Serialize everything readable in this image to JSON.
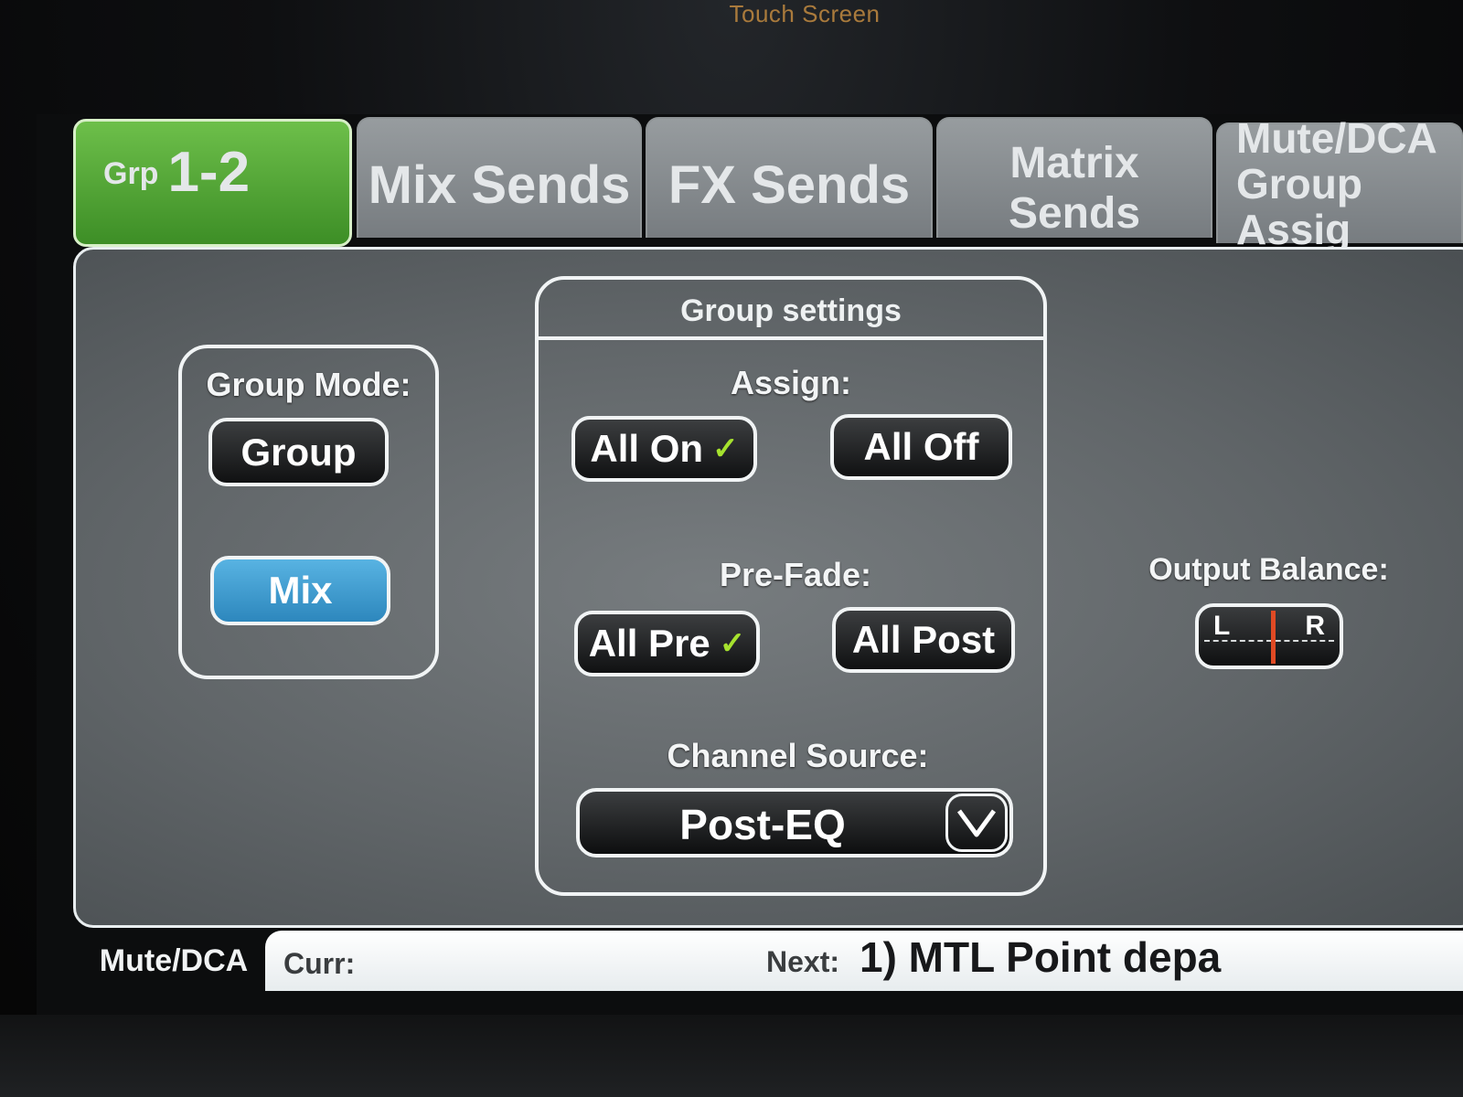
{
  "device": {
    "label": "Touch Screen"
  },
  "tabs": {
    "group": {
      "prefix": "Grp",
      "number": "1-2"
    },
    "mix_sends": "Mix Sends",
    "fx_sends": "FX Sends",
    "matrix_sends": "Matrix Sends",
    "mute_dca_group_assign": "Mute/DCA\nGroup Assig"
  },
  "group_mode": {
    "label": "Group Mode:",
    "group_button": "Group",
    "mix_button": "Mix",
    "selected": "Mix",
    "selected_color": "#3a9bd1"
  },
  "group_settings": {
    "title": "Group settings",
    "assign": {
      "label": "Assign:",
      "all_on": "All On",
      "all_off": "All Off",
      "checked": "All On",
      "check_symbol": "✓"
    },
    "pre_fade": {
      "label": "Pre-Fade:",
      "all_pre": "All Pre",
      "all_post": "All Post",
      "checked": "All Pre",
      "check_symbol": "✓"
    },
    "channel_source": {
      "label": "Channel Source:",
      "value": "Post-EQ"
    }
  },
  "output_balance": {
    "label": "Output Balance:",
    "left": "L",
    "right": "R",
    "position": "center"
  },
  "bottom_bar": {
    "mute_dca": "Mute/DCA",
    "curr_label": "Curr:",
    "next_label": "Next:",
    "next_value": "1) MTL Point depa"
  },
  "colors": {
    "active_tab": "#4fa532",
    "tick": "#a6e22e",
    "balance_marker": "#e04a24"
  }
}
